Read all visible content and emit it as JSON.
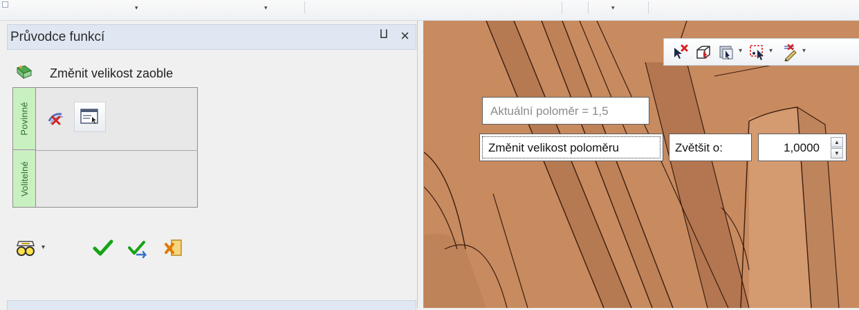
{
  "panel": {
    "title": "Průvodce funkcí",
    "pin_glyph": "⨿",
    "close_glyph": "×",
    "command_label": "Změnit velikost zaoble",
    "tabs": {
      "required": "Povinné",
      "optional": "Volitelné"
    }
  },
  "viewport": {
    "radius_readout": "Aktuální poloměr = 1,5",
    "change_radius_button": "Změnit velikost poloměru",
    "increase_label": "Zvětšit o:",
    "increase_value": "1,0000"
  },
  "icons": {
    "command": "fillet-resize-icon",
    "step_1": "select-edge-icon",
    "step_2": "dialog-option-icon",
    "preview": "preview-glasses-icon",
    "ok": "checkmark-icon",
    "apply": "apply-icon",
    "cancel": "cancel-icon",
    "view_toolbar": [
      "deselect-icon",
      "box-select-icon",
      "selection-filter-icon",
      "add-to-selection-icon",
      "filter-edit-icon"
    ]
  },
  "colors": {
    "panel_header": "#dfe7f2",
    "tab_green": "#c9f0c1",
    "model_surface": "#c88a5f",
    "check_green": "#16a316"
  }
}
